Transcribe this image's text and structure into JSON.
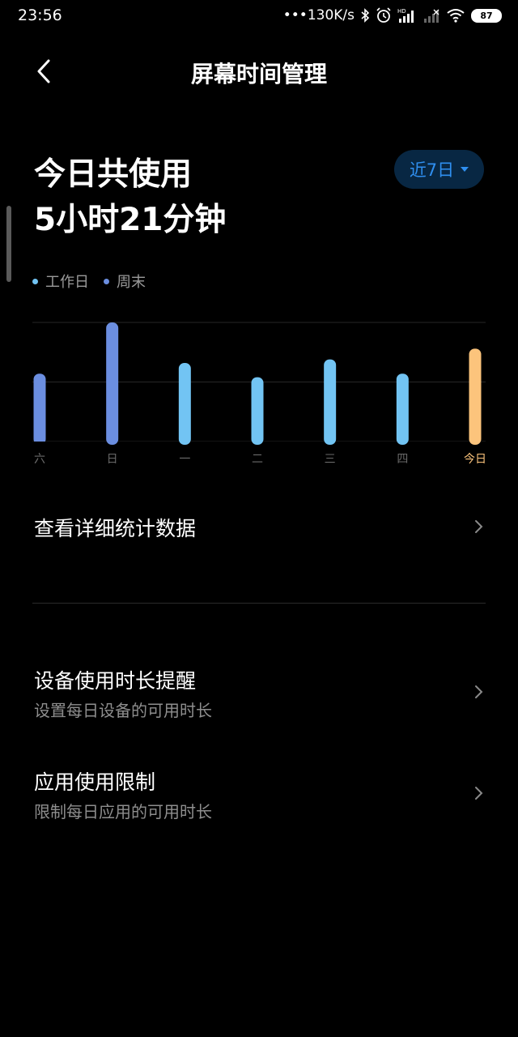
{
  "status_bar": {
    "time": "23:56",
    "network_speed": "•••130K/s",
    "battery": "87",
    "icons": [
      "bluetooth-icon",
      "alarm-icon",
      "hd-signal-icon",
      "no-signal-icon",
      "wifi-icon",
      "battery-icon"
    ]
  },
  "header": {
    "title": "屏幕时间管理",
    "back_icon": "chevron-left-icon"
  },
  "summary": {
    "label": "今日共使用",
    "value": "5小时21分钟",
    "range_label": "近7日"
  },
  "legend": {
    "weekday": "工作日",
    "weekend": "周末"
  },
  "colors": {
    "weekday": "#72c4f3",
    "weekend": "#6b8ee0",
    "today": "#fcc47c",
    "accent": "#2f8ff0",
    "grid": "#262626"
  },
  "chart_data": {
    "type": "bar",
    "categories": [
      "六",
      "日",
      "一",
      "二",
      "三",
      "四",
      "今日"
    ],
    "values": [
      5.7,
      10.0,
      6.6,
      5.4,
      6.9,
      5.7,
      7.8
    ],
    "kinds": [
      "weekend",
      "weekend",
      "weekday",
      "weekday",
      "weekday",
      "weekday",
      "today"
    ],
    "ylim": [
      0,
      10
    ],
    "grid": true
  },
  "menu": {
    "details": {
      "title": "查看详细统计数据"
    },
    "device_reminder": {
      "title": "设备使用时长提醒",
      "subtitle": "设置每日设备的可用时长"
    },
    "app_limit": {
      "title": "应用使用限制",
      "subtitle": "限制每日应用的可用时长"
    }
  }
}
